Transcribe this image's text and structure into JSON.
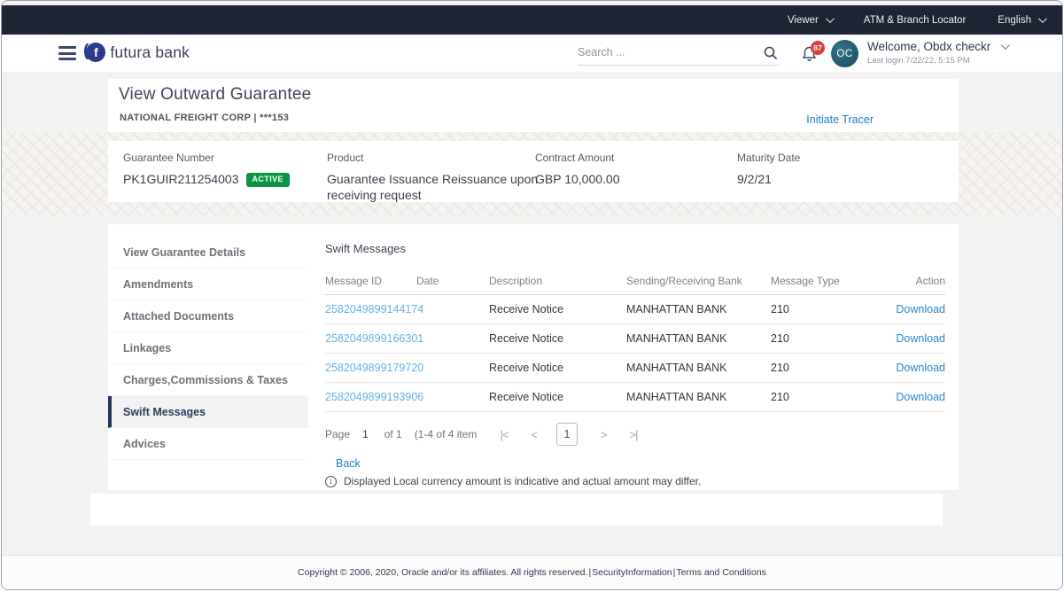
{
  "topbar": {
    "role_selector": "Viewer",
    "atm_branch_locator": "ATM & Branch Locator",
    "language": "English"
  },
  "header": {
    "brand_name": "futura bank",
    "logo_letter": "f",
    "search_placeholder": "Search ...",
    "notification_count": "87",
    "avatar_initials": "OC",
    "welcome_text": "Welcome, Obdx checkr",
    "last_login": "Last login 7/22/22, 5:15 PM"
  },
  "page_header": {
    "title": "View Outward Guarantee",
    "subtitle": "NATIONAL FREIGHT CORP | ***153",
    "initiate_tracer_label": "Initiate Tracer"
  },
  "summary": {
    "status_badge": "ACTIVE",
    "fields": [
      {
        "label": "Guarantee Number",
        "value": "PK1GUIR211254003"
      },
      {
        "label": "Product",
        "value": "Guarantee Issuance Reissuance upon receiving request"
      },
      {
        "label": "Contract Amount",
        "value": "GBP 10,000.00"
      },
      {
        "label": "Maturity Date",
        "value": "9/2/21"
      }
    ]
  },
  "sidebar": {
    "items": [
      {
        "label": "View Guarantee Details"
      },
      {
        "label": "Amendments"
      },
      {
        "label": "Attached Documents"
      },
      {
        "label": "Linkages"
      },
      {
        "label": "Charges,Commissions & Taxes"
      },
      {
        "label": "Swift Messages",
        "active": true
      },
      {
        "label": "Advices"
      }
    ]
  },
  "swift_messages": {
    "section_title": "Swift Messages",
    "columns": [
      "Message ID",
      "Date",
      "Description",
      "Sending/Receiving Bank",
      "Message Type",
      "Action"
    ],
    "rows": [
      {
        "message_id": "2582049899144174",
        "date": "",
        "description": "Receive Notice",
        "bank": "MANHATTAN BANK",
        "message_type": "210",
        "action": "Download"
      },
      {
        "message_id": "2582049899166301",
        "date": "",
        "description": "Receive Notice",
        "bank": "MANHATTAN BANK",
        "message_type": "210",
        "action": "Download"
      },
      {
        "message_id": "2582049899179720",
        "date": "",
        "description": "Receive Notice",
        "bank": "MANHATTAN BANK",
        "message_type": "210",
        "action": "Download"
      },
      {
        "message_id": "2582049899193906",
        "date": "",
        "description": "Receive Notice",
        "bank": "MANHATTAN BANK",
        "message_type": "210",
        "action": "Download"
      }
    ],
    "pagination": {
      "page_label": "Page",
      "current_page": "1",
      "of_label": "of 1",
      "range_label": "(1-4 of 4 item",
      "first_icon": "|<",
      "prev_icon": "<",
      "next_icon": ">",
      "last_icon": ">|"
    },
    "back_label": "Back",
    "note": "Displayed Local currency amount is indicative and actual amount may differ.",
    "info_icon_glyph": "i"
  },
  "footer": {
    "copyright": "Copyright © 2006, 2020, Oracle and/or its affiliates. All rights reserved.",
    "separator": "|",
    "security_link": "SecurityInformation",
    "terms_link": "Terms and Conditions"
  },
  "colors": {
    "topbar_bg": "#1d2433",
    "brand_navy": "#2e3a8a",
    "accent_blue": "#1a7ec6",
    "link_light_blue": "#66b0e8",
    "status_green": "#0b9444",
    "badge_red": "#e23d3d"
  }
}
